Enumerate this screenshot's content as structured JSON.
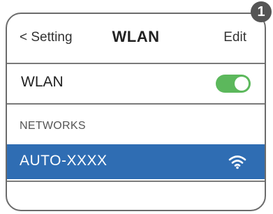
{
  "step_badge": "1",
  "nav": {
    "back_label": "< Setting",
    "title": "WLAN",
    "edit_label": "Edit"
  },
  "wlan": {
    "label": "WLAN",
    "enabled": true,
    "toggle_color": "#5cb85c"
  },
  "networks": {
    "header": "NETWORKS",
    "items": [
      {
        "name": "AUTO-XXXX",
        "selected": true,
        "icon": "wifi-icon",
        "highlight_color": "#2f6db3"
      }
    ]
  }
}
